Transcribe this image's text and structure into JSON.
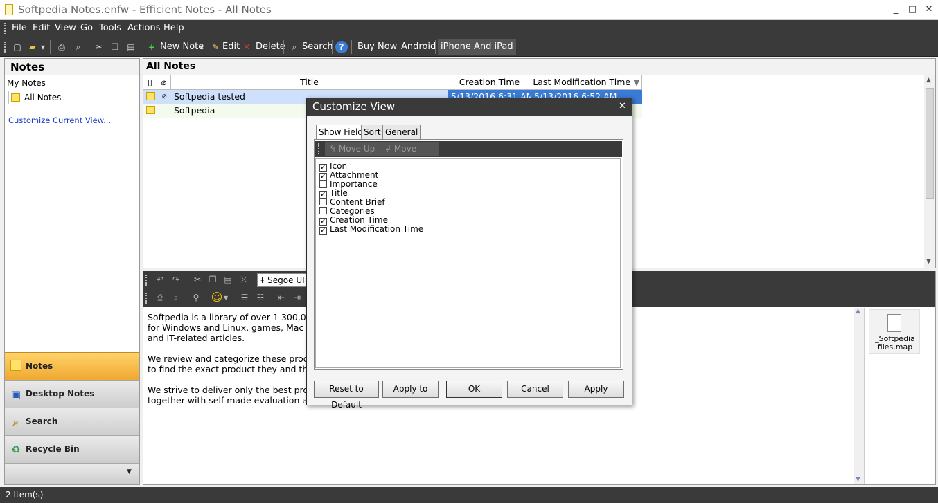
{
  "window": {
    "title": "Softpedia Notes.enfw - Efficient Notes - All Notes",
    "minimize": "_",
    "maximize": "□",
    "close": "✕"
  },
  "menu": [
    "File",
    "Edit",
    "View",
    "Go",
    "Tools",
    "Actions",
    "Help"
  ],
  "toolbar": {
    "new_note": "New Note",
    "edit": "Edit",
    "delete": "Delete",
    "search": "Search",
    "buy_now": "Buy Now",
    "android": "Android",
    "iphone": "iPhone And iPad"
  },
  "left": {
    "title": "Notes",
    "tree_root": "My Notes",
    "tree_item": "All Notes",
    "customize_link": "Customize Current View...",
    "nav": [
      "Notes",
      "Desktop Notes",
      "Search",
      "Recycle Bin"
    ]
  },
  "list": {
    "title": "All Notes",
    "columns": [
      "Title",
      "Creation Time",
      "Last Modification Time"
    ],
    "rows": [
      {
        "title": "Softpedia tested",
        "created": "5/13/2016 6:31 AM",
        "modified": "5/13/2016 6:52 AM"
      },
      {
        "title": "Softpedia",
        "created": "",
        "modified": ""
      }
    ]
  },
  "editor": {
    "font": "Segoe UI",
    "lines": [
      "Softpedia is a library of over 1 300,000 free a",
      "for Windows and Linux, games, Mac softwa",
      "and IT-related articles.",
      "We review and categorize these products in",
      "to find the exact product they and their syst",
      "We strive to deliver only the best products t",
      "together with self-made evaluation and rev"
    ],
    "attachment": "_Softpedia files.map"
  },
  "status": "2 Item(s)",
  "dialog": {
    "title": "Customize View",
    "close": "✕",
    "tabs": [
      "Show Fields",
      "Sort",
      "General"
    ],
    "move_up": "Move Up",
    "move_down": "Move Down",
    "fields": [
      {
        "label": "Icon",
        "checked": true
      },
      {
        "label": "Attachment",
        "checked": true
      },
      {
        "label": "Importance",
        "checked": false
      },
      {
        "label": "Title",
        "checked": true
      },
      {
        "label": "Content Brief",
        "checked": false
      },
      {
        "label": "Categories",
        "checked": false
      },
      {
        "label": "Creation Time",
        "checked": true
      },
      {
        "label": "Last Modification Time",
        "checked": true
      }
    ],
    "buttons": {
      "reset": "Reset to Default",
      "apply_to": "Apply to",
      "ok": "OK",
      "cancel": "Cancel",
      "apply": "Apply"
    }
  }
}
